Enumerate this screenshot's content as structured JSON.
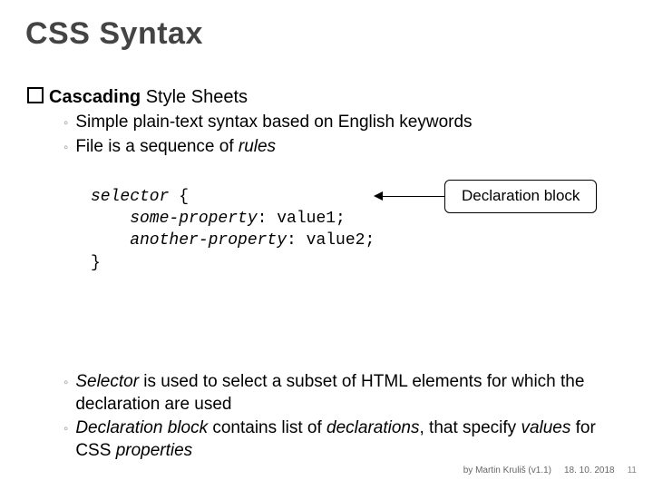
{
  "title": "CSS Syntax",
  "heading": {
    "lead": "Cascading",
    "rest": " Style Sheets"
  },
  "bul1": "Simple plain-text syntax based on English keywords",
  "bul2a": "File is a sequence of ",
  "bul2b": "rules",
  "code": {
    "l1a": "selector",
    "l1b": " {",
    "l2a": "    some-property",
    "l2b": ": value1;",
    "l3a": "    another-property",
    "l3b": ": value2;",
    "l4": "}"
  },
  "callout": "Declaration block",
  "bul3a": "Selector",
  "bul3b": " is used to select a subset of HTML elements for which the declaration are used",
  "bul4a": "Declaration block",
  "bul4b": " contains list of ",
  "bul4c": "declarations",
  "bul4d": ", that specify ",
  "bul4e": "values",
  "bul4f": " for CSS ",
  "bul4g": "properties",
  "footer": {
    "author": "by Martin Kruliš (v1.1)",
    "date": "18. 10. 2018",
    "page": "11"
  }
}
